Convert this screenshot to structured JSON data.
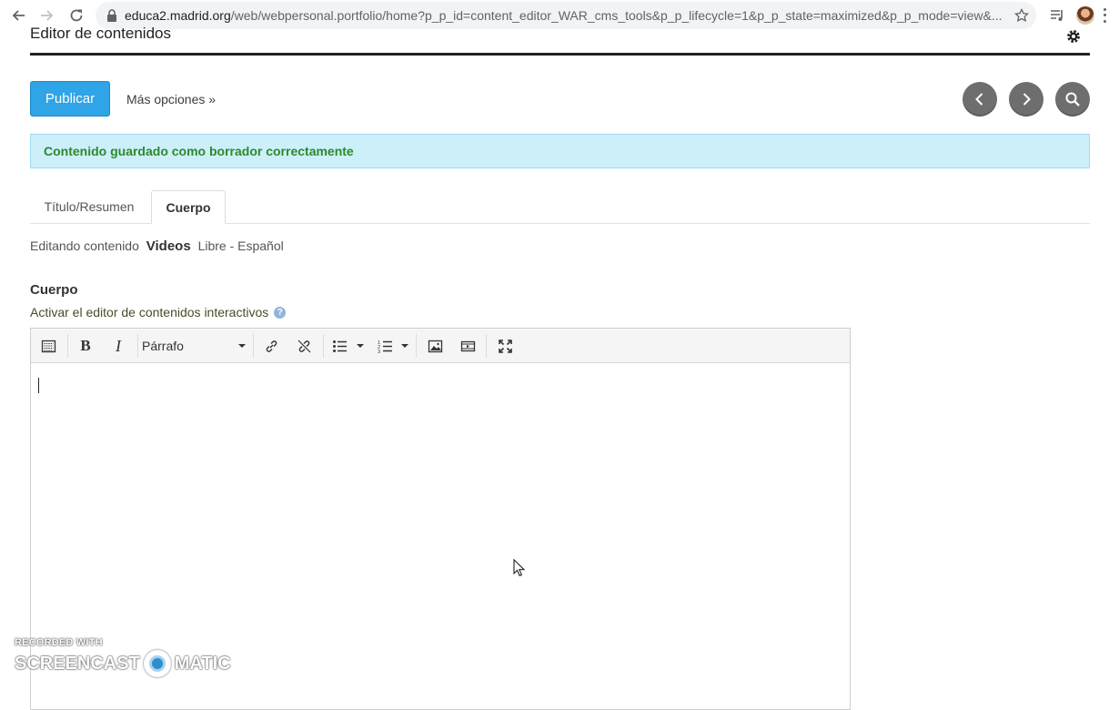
{
  "browser": {
    "url_host": "educa2.madrid.org",
    "url_path": "/web/webpersonal.portfolio/home?p_p_id=content_editor_WAR_cms_tools&p_p_lifecycle=1&p_p_state=maximized&p_p_mode=view&..."
  },
  "page": {
    "title": "Editor de contenidos",
    "publish_label": "Publicar",
    "more_options_label": "Más opciones »",
    "alert_message": "Contenido guardado como borrador correctamente"
  },
  "tabs": [
    {
      "label": "Título/Resumen",
      "active": false
    },
    {
      "label": "Cuerpo",
      "active": true
    }
  ],
  "editing": {
    "prefix": "Editando contenido",
    "type": "Videos",
    "suffix": "Libre - Español"
  },
  "field": {
    "label": "Cuerpo",
    "activate_label": "Activar el editor de contenidos interactivos",
    "help": "?"
  },
  "editor": {
    "format_value": "Párrafo",
    "bold_label": "B",
    "italic_label": "I"
  },
  "watermark": {
    "line1": "RECORDED WITH",
    "brand_left": "SCREENCAST",
    "brand_right": "MATIC"
  },
  "colors": {
    "primary": "#2fa4e7",
    "alert_bg": "#cdeffa",
    "alert_text": "#2b8a2b",
    "circle_btn": "#6e6e6e"
  }
}
